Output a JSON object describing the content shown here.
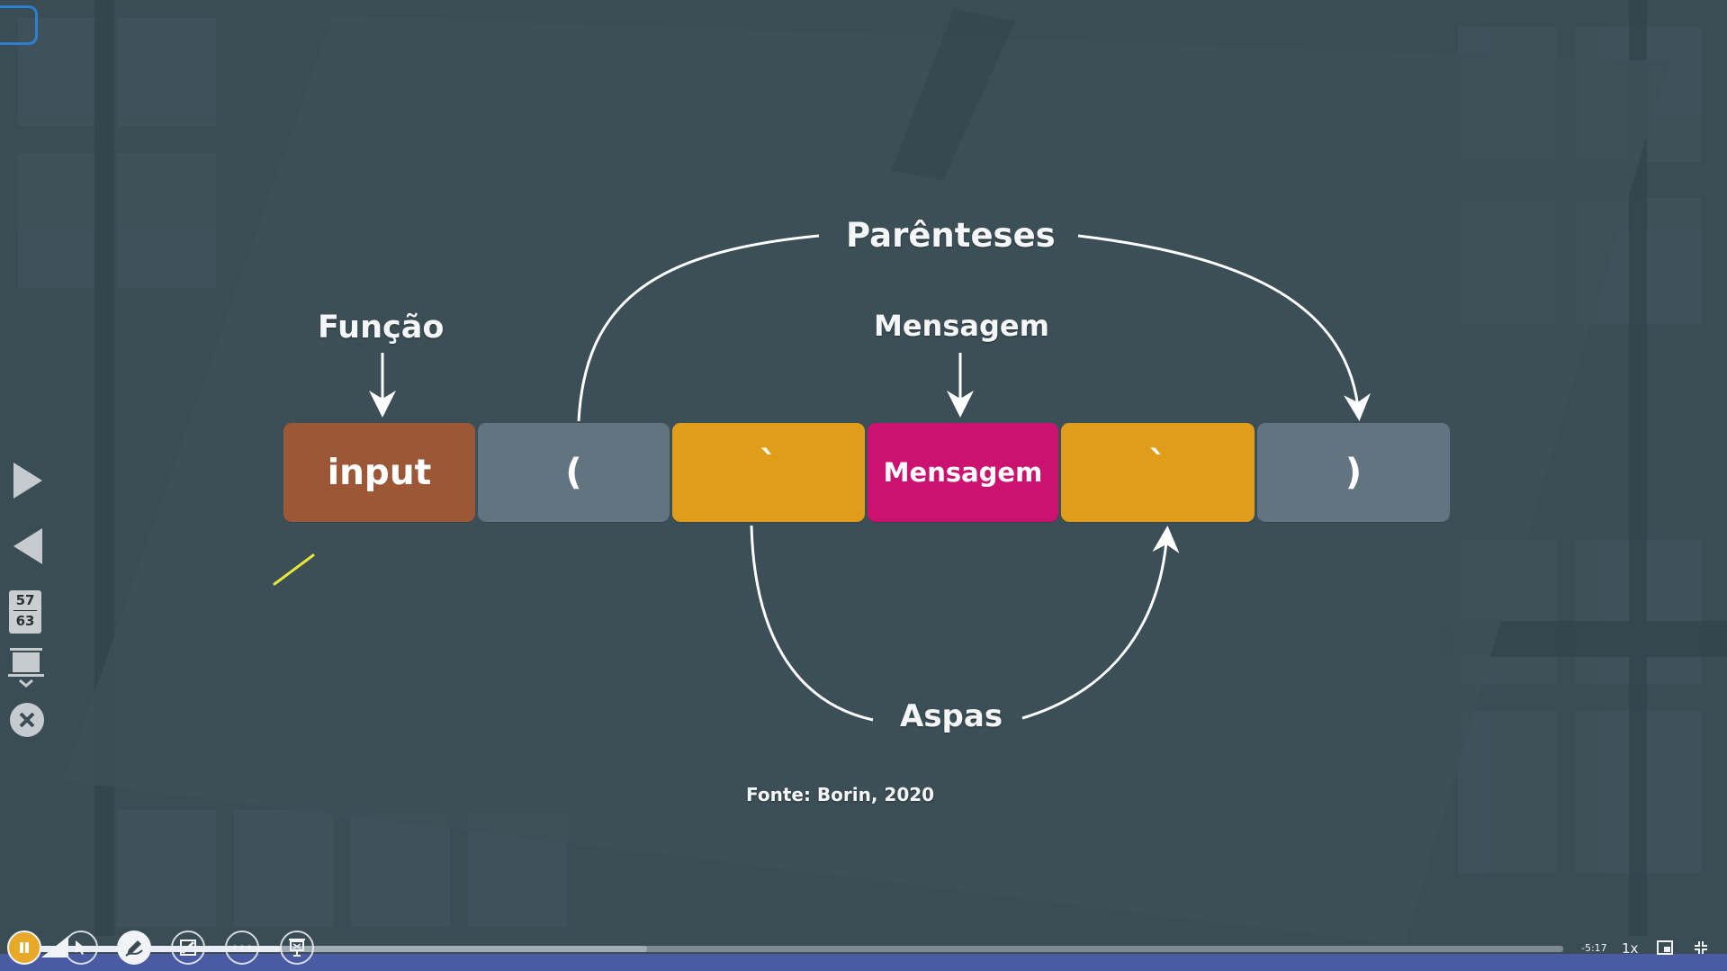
{
  "slide": {
    "label_parenteses": "Parênteses",
    "label_funcao": "Função",
    "label_mensagem": "Mensagem",
    "label_aspas": "Aspas",
    "source": "Fonte: Borin, 2020",
    "tiles": [
      {
        "text": "input",
        "color": "#9c5737"
      },
      {
        "text": "(",
        "color": "#627480"
      },
      {
        "text": "`",
        "color": "#e09d19"
      },
      {
        "text": "Mensagem",
        "color": "#cb1271"
      },
      {
        "text": "`",
        "color": "#e09d19"
      },
      {
        "text": ")",
        "color": "#627480"
      }
    ]
  },
  "navigation": {
    "current_slide": "57",
    "total_slides": "63"
  },
  "player": {
    "time_remaining": "-5:17",
    "playback_speed": "1x",
    "progress_fraction": 0.16,
    "buffer_fraction": 0.4
  },
  "colors": {
    "background": "#3a4c54",
    "accent_blue": "#4a5aa3"
  },
  "icons": [
    "play-next-icon",
    "play-prev-icon",
    "presenter-icon",
    "close-icon",
    "pause-icon",
    "volume-icon",
    "cursor-icon",
    "pen-icon",
    "eraser-icon",
    "more-icon",
    "presentation-icon",
    "pip-icon",
    "collapse-icon"
  ]
}
